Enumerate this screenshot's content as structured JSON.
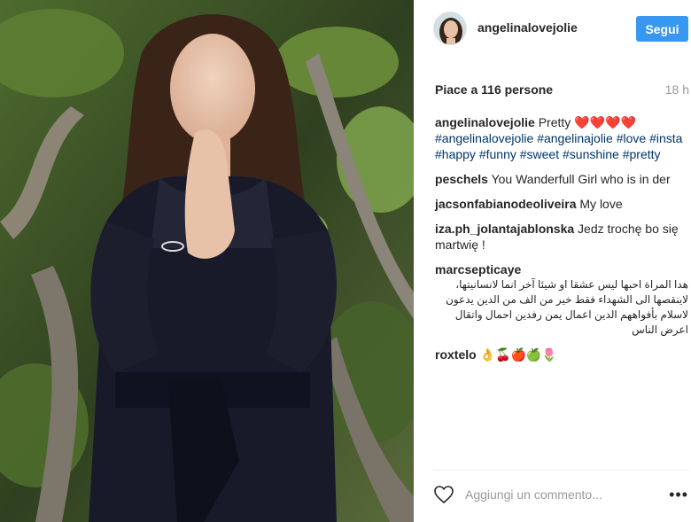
{
  "post": {
    "username": "angelinalovejolie",
    "follow_label": "Segui",
    "likes_text": "Piace a 116 persone",
    "time_ago": "18 h"
  },
  "comments": [
    {
      "user": "angelinalovejolie",
      "text": "Pretty ",
      "hearts": "❤️❤️❤️❤️",
      "hashtags": "#angelinalovejolie #angelinajolie #love #insta #happy #funny #sweet #sunshine #pretty"
    },
    {
      "user": "peschels",
      "text": "You Wanderfull Girl who is in der"
    },
    {
      "user": "jacsonfabianodeoliveira",
      "text": "My love"
    },
    {
      "user": "iza.ph_jolantajablonska",
      "text": "Jedz trochę bo się martwię !"
    },
    {
      "user": "marcsepticaye",
      "text": "هدا المراة احبها ليس عشقا او شيئا آخر انما لانسانيتها، لاينقصها الى الشهداء فقط خير من الف من الدين يدعون لاسلام بأفواههم الدين اعمال يمن رفدين احمال واتقال اعرض الناس"
    },
    {
      "user": "roxtelo",
      "text": "👌🍒🍎🍏🌷"
    }
  ],
  "comment_box": {
    "placeholder": "Aggiungi un commento..."
  },
  "icons": {
    "like": "heart-outline-icon",
    "more": "more-options-icon"
  },
  "colors": {
    "accent": "#3897f0",
    "hashtag": "#003569",
    "muted": "#999999"
  }
}
